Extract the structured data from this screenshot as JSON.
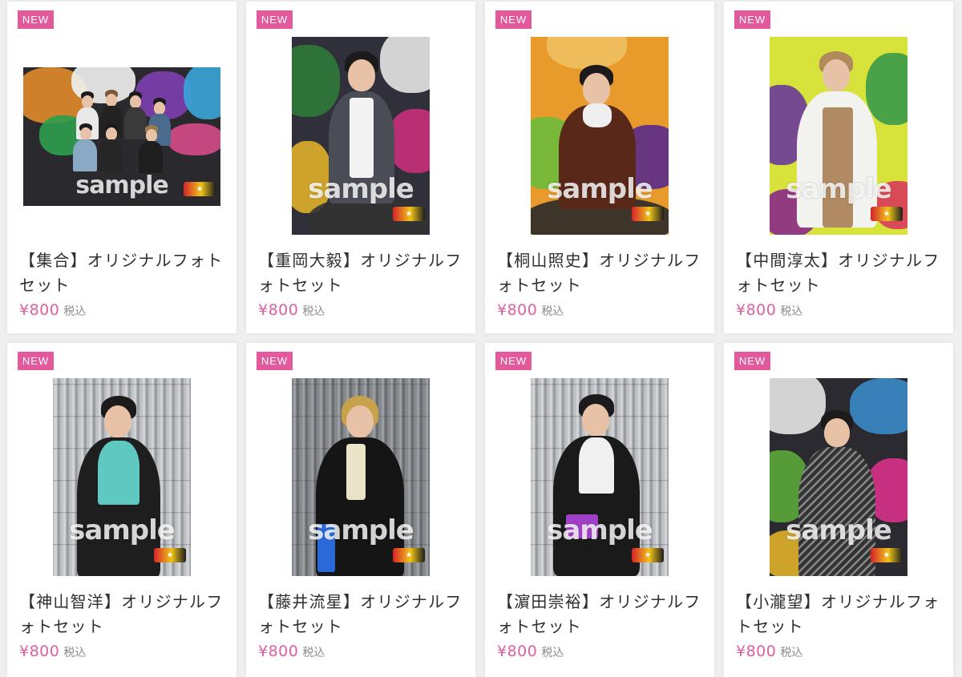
{
  "colors": {
    "accent": "#e2599c",
    "price": "#e0609f",
    "tax": "#8a8a8a",
    "title": "#2f2f2f",
    "card": "#ffffff",
    "background": "#efefef"
  },
  "products": [
    {
      "badge": "NEW",
      "title": "【集合】オリジナルフォトセット",
      "price": "¥800",
      "tax": "税込",
      "watermark": "sample",
      "photo_alt": "集合 photo"
    },
    {
      "badge": "NEW",
      "title": "【重岡大毅】オリジナルフォトセット",
      "price": "¥800",
      "tax": "税込",
      "watermark": "sample",
      "photo_alt": "重岡大毅 photo"
    },
    {
      "badge": "NEW",
      "title": "【桐山照史】オリジナルフォトセット",
      "price": "¥800",
      "tax": "税込",
      "watermark": "sample",
      "photo_alt": "桐山照史 photo"
    },
    {
      "badge": "NEW",
      "title": "【中間淳太】オリジナルフォトセット",
      "price": "¥800",
      "tax": "税込",
      "watermark": "sample",
      "photo_alt": "中間淳太 photo"
    },
    {
      "badge": "NEW",
      "title": "【神山智洋】オリジナルフォトセット",
      "price": "¥800",
      "tax": "税込",
      "watermark": "sample",
      "photo_alt": "神山智洋 photo"
    },
    {
      "badge": "NEW",
      "title": "【藤井流星】オリジナルフォトセット",
      "price": "¥800",
      "tax": "税込",
      "watermark": "sample",
      "photo_alt": "藤井流星 photo"
    },
    {
      "badge": "NEW",
      "title": "【濵田崇裕】オリジナルフォトセット",
      "price": "¥800",
      "tax": "税込",
      "watermark": "sample",
      "photo_alt": "濵田崇裕 photo"
    },
    {
      "badge": "NEW",
      "title": "【小瀧望】オリジナルフォトセット",
      "price": "¥800",
      "tax": "税込",
      "watermark": "sample",
      "photo_alt": "小瀧望 photo"
    }
  ]
}
